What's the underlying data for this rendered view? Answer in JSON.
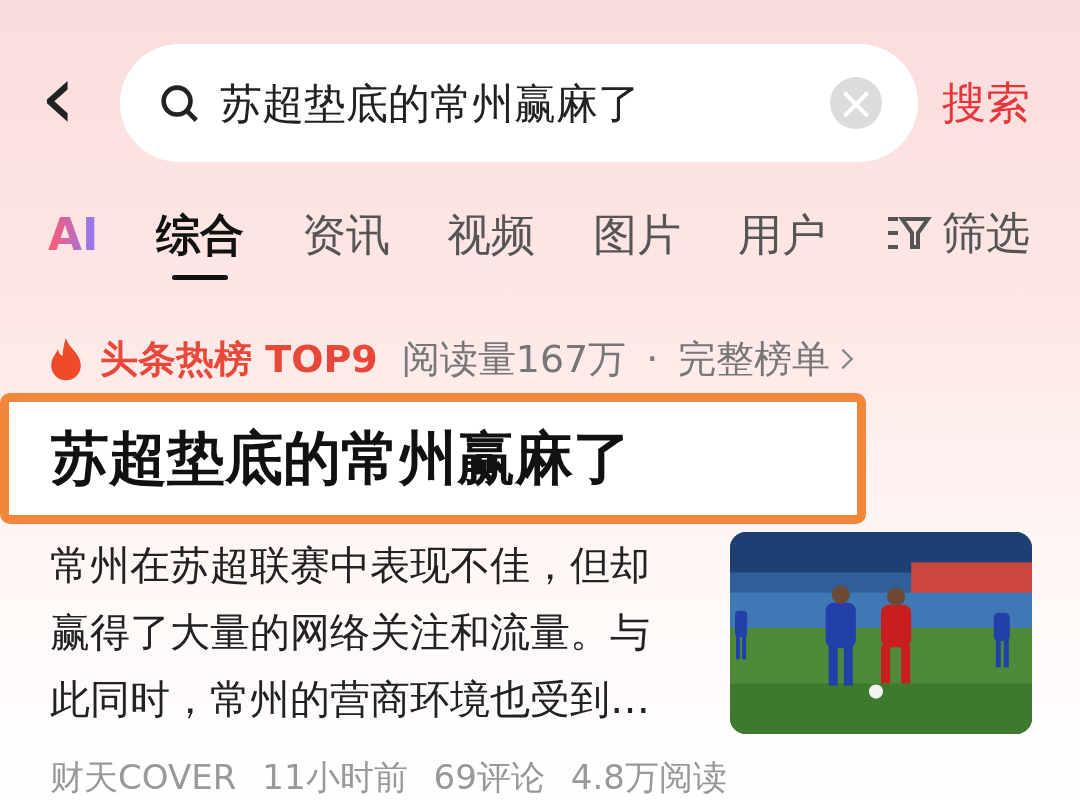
{
  "search": {
    "back": "‹",
    "query": "苏超垫底的常州赢麻了",
    "clear": "×",
    "action": "搜索"
  },
  "tabs": [
    {
      "label": "AI",
      "kind": "ai",
      "selected": false
    },
    {
      "label": "综合",
      "kind": "text",
      "selected": true
    },
    {
      "label": "资讯",
      "kind": "text",
      "selected": false
    },
    {
      "label": "视频",
      "kind": "text",
      "selected": false
    },
    {
      "label": "图片",
      "kind": "text",
      "selected": false
    },
    {
      "label": "用户",
      "kind": "text",
      "selected": false
    }
  ],
  "filter": {
    "label": "筛选"
  },
  "hot": {
    "label": "头条热榜 TOP9",
    "reads": "阅读量167万",
    "separator": "·",
    "link": "完整榜单"
  },
  "article": {
    "title": "苏超垫底的常州赢麻了",
    "summary": "常州在苏超联赛中表现不佳，但却赢得了大量的网络关注和流量。与此同时，常州的营商环境也受到…",
    "meta": [
      "财天COVER",
      "11小时前",
      "69评论",
      "4.8万阅读"
    ]
  }
}
